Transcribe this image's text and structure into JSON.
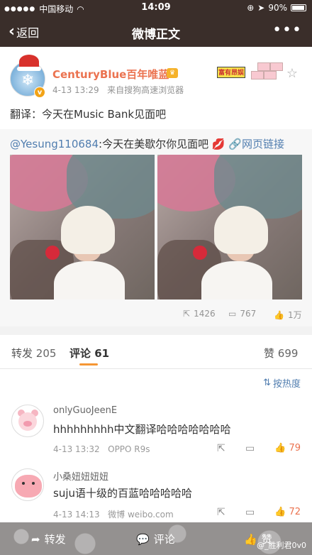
{
  "status_bar": {
    "carrier": "中国移动",
    "time": "14:09",
    "battery": "90%"
  },
  "nav": {
    "back_label": "返回",
    "title": "微博正文",
    "more_icon": "•••"
  },
  "post": {
    "username": "CenturyBlue百年唯蓝",
    "time": "4-13 13:29",
    "source": "来自搜狗高速浏览器",
    "text": "翻译：今天在Music Bank见面吧",
    "sticker_tag": "富有昂娱",
    "repost": {
      "mention": "@Yesung110684",
      "text": ":今天在美歇尔你见面吧",
      "emoji": "💋",
      "link_label": "网页链接",
      "repost_count": "1426",
      "comment_count": "767",
      "like_count": "1万"
    }
  },
  "tabs": {
    "repost_label": "转发",
    "repost_count": "205",
    "comment_label": "评论",
    "comment_count": "61",
    "like_label": "赞",
    "like_count": "699"
  },
  "comments": {
    "sort_label": "按热度",
    "items": [
      {
        "name": "onlyGuoJeenE",
        "text": "hhhhhhhhh中文翻译哈哈哈哈哈哈哈",
        "time": "4-13 13:32",
        "source": "OPPO R9s",
        "likes": "79"
      },
      {
        "name": "小桑妞妞妞妞",
        "text": "suju语十级的百蓝哈哈哈哈哈",
        "time": "4-13 14:13",
        "source": "微博 weibo.com",
        "likes": "72"
      }
    ]
  },
  "toolbar": {
    "repost_label": "转发",
    "comment_label": "评论",
    "like_label": "赞",
    "watermark": "@_胜利君0v0"
  },
  "colors": {
    "nav_bg": "#3a2e2a",
    "username": "#eb7350",
    "link": "#507daf",
    "accent_underline": "#f59634"
  }
}
